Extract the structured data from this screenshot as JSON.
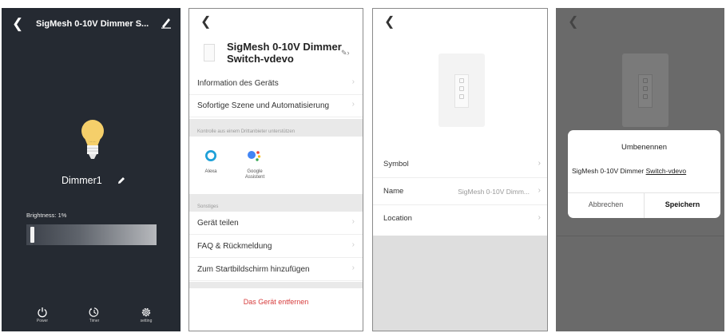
{
  "panel1": {
    "back_icon": "chevron-left-icon",
    "title": "SigMesh 0-10V Dimmer S...",
    "edit_icon": "edit-icon",
    "device_name": "Dimmer1",
    "brightness_label": "Brightness: 1%",
    "brightness_value": 1,
    "bottom": {
      "power_label": "Power",
      "timer_label": "Timer",
      "settings_label": "setting"
    }
  },
  "panel2": {
    "back_icon": "chevron-left-icon",
    "device_title_line1": "SigMesh 0-10V Dimmer",
    "device_title_line2": "Switch-vdevo",
    "rows": [
      {
        "label": "Information des Geräts"
      },
      {
        "label": "Sofortige Szene und Automatisierung"
      }
    ],
    "section_control": "Kontrolle aus einem Drittanbieter unterstützen",
    "assistants": [
      {
        "label": "Alexa"
      },
      {
        "label_line1": "Google",
        "label_line2": "Assistent"
      }
    ],
    "section_other": "Sonstiges",
    "other_rows": [
      {
        "label": "Gerät teilen"
      },
      {
        "label": "FAQ & Rückmeldung"
      },
      {
        "label": "Zum Startbildschirm hinzufügen"
      }
    ],
    "remove_label": "Das Gerät entfernen"
  },
  "panel3": {
    "back_icon": "chevron-left-icon",
    "rows": [
      {
        "label": "Symbol",
        "value": ""
      },
      {
        "label": "Name",
        "value": "SigMesh 0-10V Dimm..."
      },
      {
        "label": "Location",
        "value": ""
      }
    ]
  },
  "panel4": {
    "back_icon": "chevron-left-icon",
    "dialog": {
      "title": "Umbenennen",
      "input_text_plain": "SigMesh 0-10V Dimmer ",
      "input_text_underlined": "Switch-vdevo",
      "cancel_label": "Abbrechen",
      "save_label": "Speichern"
    }
  },
  "colors": {
    "dark_bg": "#252a32",
    "bulb_yellow": "#f5cf6a",
    "remove_red": "#d63b3b",
    "alexa_blue": "#1ea0d8",
    "overlay_gray": "#6a6a6a"
  }
}
